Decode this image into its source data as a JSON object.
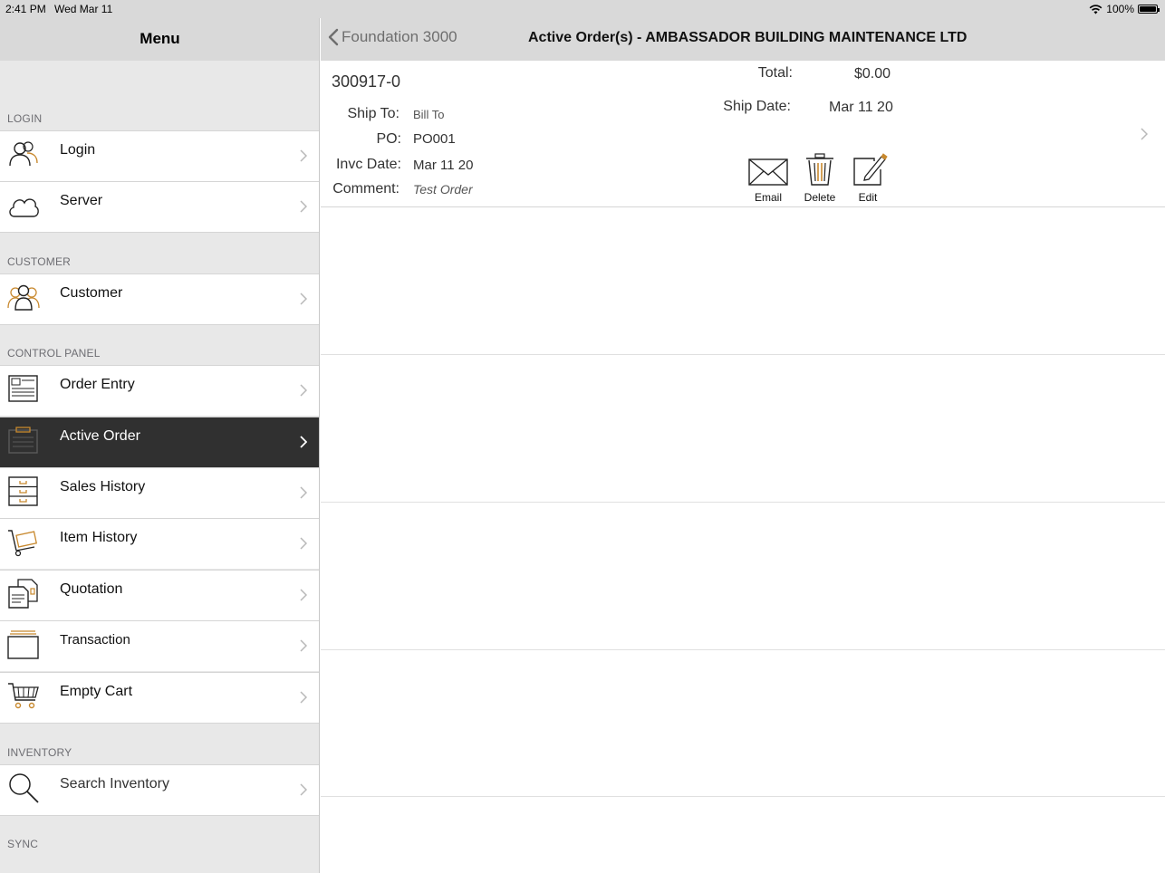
{
  "status": {
    "time": "2:41 PM",
    "date": "Wed Mar 11",
    "battery": "100%"
  },
  "nav": {
    "menu_title": "Menu",
    "back_label": "Foundation 3000",
    "title": "Active Order(s) - AMBASSADOR BUILDING MAINTENANCE LTD"
  },
  "sidebar": {
    "sections": {
      "login": "LOGIN",
      "customer": "CUSTOMER",
      "control_panel": "CONTROL PANEL",
      "inventory": "INVENTORY",
      "sync": "SYNC"
    },
    "items": {
      "login": {
        "label": "Login",
        "icon": "users-icon"
      },
      "server": {
        "label": "Server",
        "icon": "cloud-icon"
      },
      "customer": {
        "label": "Customer",
        "icon": "group-icon"
      },
      "order_entry": {
        "label": "Order Entry",
        "icon": "order-form-icon"
      },
      "active_order": {
        "label": "Active Order",
        "icon": "clipboard-icon",
        "selected": true
      },
      "sales_history": {
        "label": "Sales History",
        "icon": "cabinet-icon"
      },
      "item_history": {
        "label": "Item History",
        "icon": "hand-truck-icon"
      },
      "quotation": {
        "label": "Quotation",
        "icon": "document-icon"
      },
      "transaction": {
        "label": "Transaction",
        "icon": "tray-icon"
      },
      "empty_cart": {
        "label": "Empty Cart",
        "icon": "cart-icon"
      },
      "search_inventory": {
        "label": "Search Inventory",
        "icon": "search-icon"
      }
    }
  },
  "order": {
    "number": "300917-0",
    "ship_to_label": "Ship To:",
    "ship_to": "Bill To",
    "po_label": "PO:",
    "po": "PO001",
    "invc_date_label": "Invc Date:",
    "invc_date": "Mar 11 20",
    "comment_label": "Comment:",
    "comment": "Test Order",
    "total_label": "Total:",
    "total": "$0.00",
    "ship_date_label": "Ship Date:",
    "ship_date": "Mar 11 20",
    "actions": {
      "email": "Email",
      "delete": "Delete",
      "edit": "Edit"
    }
  },
  "colors": {
    "accent_orange": "#c8892e",
    "selected_bg": "#303030",
    "nav_bg": "#d9d9d9"
  }
}
